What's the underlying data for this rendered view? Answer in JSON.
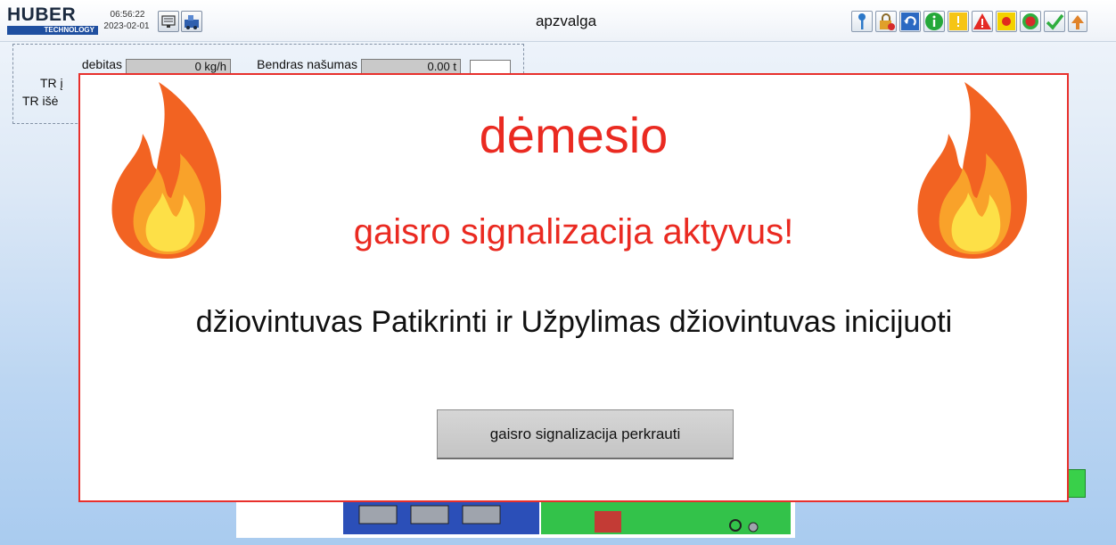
{
  "header": {
    "logo_text": "HUBER",
    "logo_sub": "TECHNOLOGY",
    "time": "06:56:22",
    "date": "2023-02-01",
    "title": "apzvalga"
  },
  "toolbar_icons": [
    "key-icon",
    "lock-icon",
    "undo-icon",
    "info-icon",
    "warning-yellow-icon",
    "warning-red-icon",
    "record-icon",
    "alarm-icon",
    "check-icon",
    "up-arrow-icon"
  ],
  "panel": {
    "debitas_label": "debitas",
    "debitas_value": "0 kg/h",
    "nasumas_label": "Bendras našumas",
    "nasumas_value": "0.00 t",
    "tr_in_label": "TR į",
    "tr_out_label": "TR išė"
  },
  "dialog": {
    "title": "dėmesio",
    "subtitle": "gaisro signalizacija aktyvus!",
    "message": "džiovintuvas Patikrinti ir Užpylimas džiovintuvas inicijuoti",
    "button": "gaisro signalizacija perkrauti"
  },
  "colors": {
    "alert_red": "#ea2a21",
    "dialog_border": "#e8302c",
    "logo_blue": "#1f4fa0"
  }
}
